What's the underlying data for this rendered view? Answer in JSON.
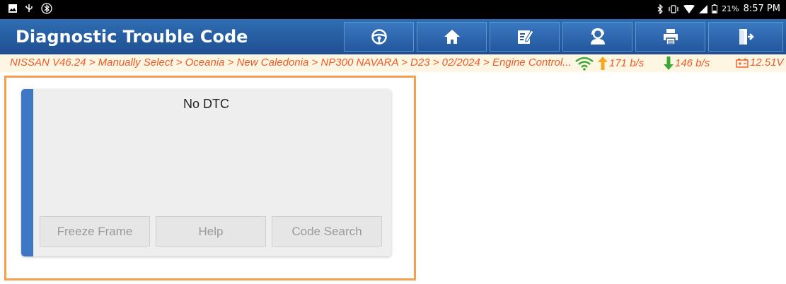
{
  "statusbar": {
    "battery": "21%",
    "time": "8:57 PM"
  },
  "header": {
    "title": "Diagnostic Trouble Code",
    "toolbar": [
      {
        "icon": "steering-wheel-icon"
      },
      {
        "icon": "home-icon"
      },
      {
        "icon": "edit-report-icon"
      },
      {
        "icon": "remote-support-icon"
      },
      {
        "icon": "printer-icon"
      },
      {
        "icon": "exit-icon"
      }
    ]
  },
  "breadcrumb": {
    "path": "NISSAN V46.24 > Manually Select > Oceania > New Caledonia > NP300 NAVARA > D23 > 02/2024 > Engine Control...",
    "upload": "171 b/s",
    "download": "146 b/s",
    "voltage": "12.51V",
    "colors": {
      "path": "#f05a28",
      "upload_arrow": "#f5a623",
      "download_arrow": "#3aa935",
      "wifi": "#3aa935",
      "voltage": "#f05a28"
    }
  },
  "dtc": {
    "message": "No DTC",
    "buttons": {
      "freeze_frame": "Freeze Frame",
      "help": "Help",
      "code_search": "Code Search"
    }
  },
  "colors": {
    "title_bar": "#2458a0",
    "card_accent": "#3e77c4",
    "panel_border": "#f4a051"
  }
}
